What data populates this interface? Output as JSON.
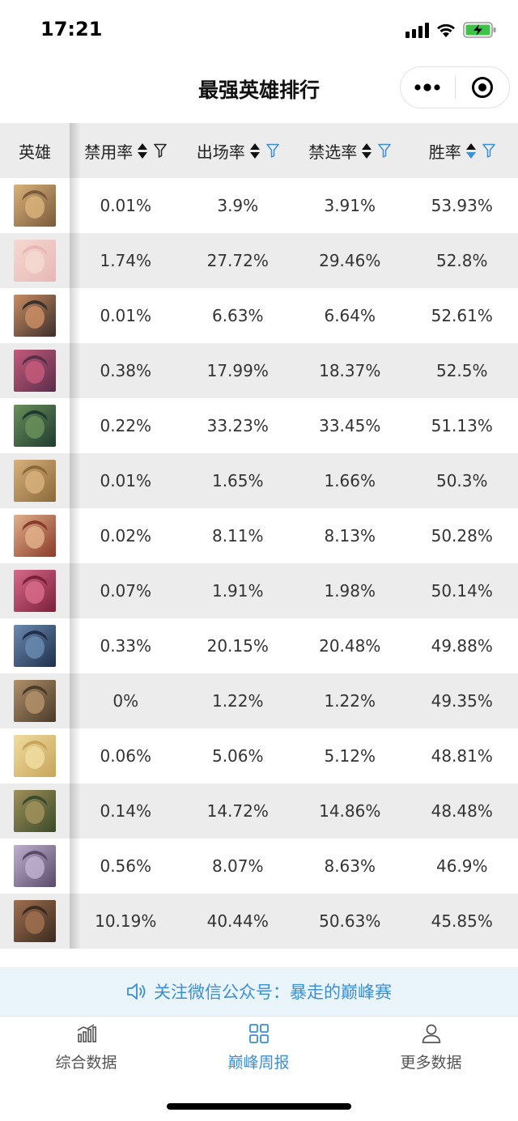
{
  "status_bar": {
    "time": "17:21"
  },
  "nav": {
    "title": "最强英雄排行"
  },
  "table": {
    "headers": {
      "hero": "英雄",
      "ban_rate": "禁用率",
      "appear_rate": "出场率",
      "pick_rate": "禁选率",
      "win_rate": "胜率"
    },
    "sorted_column": "win_rate",
    "sort_direction": "descending",
    "rows": [
      {
        "ban": "0.01%",
        "appear": "3.9%",
        "pick": "3.91%",
        "win": "53.93%"
      },
      {
        "ban": "1.74%",
        "appear": "27.72%",
        "pick": "29.46%",
        "win": "52.8%"
      },
      {
        "ban": "0.01%",
        "appear": "6.63%",
        "pick": "6.64%",
        "win": "52.61%"
      },
      {
        "ban": "0.38%",
        "appear": "17.99%",
        "pick": "18.37%",
        "win": "52.5%"
      },
      {
        "ban": "0.22%",
        "appear": "33.23%",
        "pick": "33.45%",
        "win": "51.13%"
      },
      {
        "ban": "0.01%",
        "appear": "1.65%",
        "pick": "1.66%",
        "win": "50.3%"
      },
      {
        "ban": "0.02%",
        "appear": "8.11%",
        "pick": "8.13%",
        "win": "50.28%"
      },
      {
        "ban": "0.07%",
        "appear": "1.91%",
        "pick": "1.98%",
        "win": "50.14%"
      },
      {
        "ban": "0.33%",
        "appear": "20.15%",
        "pick": "20.48%",
        "win": "49.88%"
      },
      {
        "ban": "0%",
        "appear": "1.22%",
        "pick": "1.22%",
        "win": "49.35%"
      },
      {
        "ban": "0.06%",
        "appear": "5.06%",
        "pick": "5.12%",
        "win": "48.81%"
      },
      {
        "ban": "0.14%",
        "appear": "14.72%",
        "pick": "14.86%",
        "win": "48.48%"
      },
      {
        "ban": "0.56%",
        "appear": "8.07%",
        "pick": "8.63%",
        "win": "46.9%"
      },
      {
        "ban": "10.19%",
        "appear": "40.44%",
        "pick": "50.63%",
        "win": "45.85%"
      }
    ]
  },
  "notice": {
    "icon": "speaker-icon",
    "text": "关注微信公众号：暴走的巅峰赛"
  },
  "tabs": [
    {
      "label": "综合数据",
      "icon": "bar-chart-icon",
      "active": false
    },
    {
      "label": "巅峰周报",
      "icon": "grid-icon",
      "active": true
    },
    {
      "label": "更多数据",
      "icon": "user-icon",
      "active": false
    }
  ],
  "colors": {
    "accent": "#3a8fd6",
    "row_alt": "#ececec",
    "notice_bg": "#eaf4fb"
  }
}
